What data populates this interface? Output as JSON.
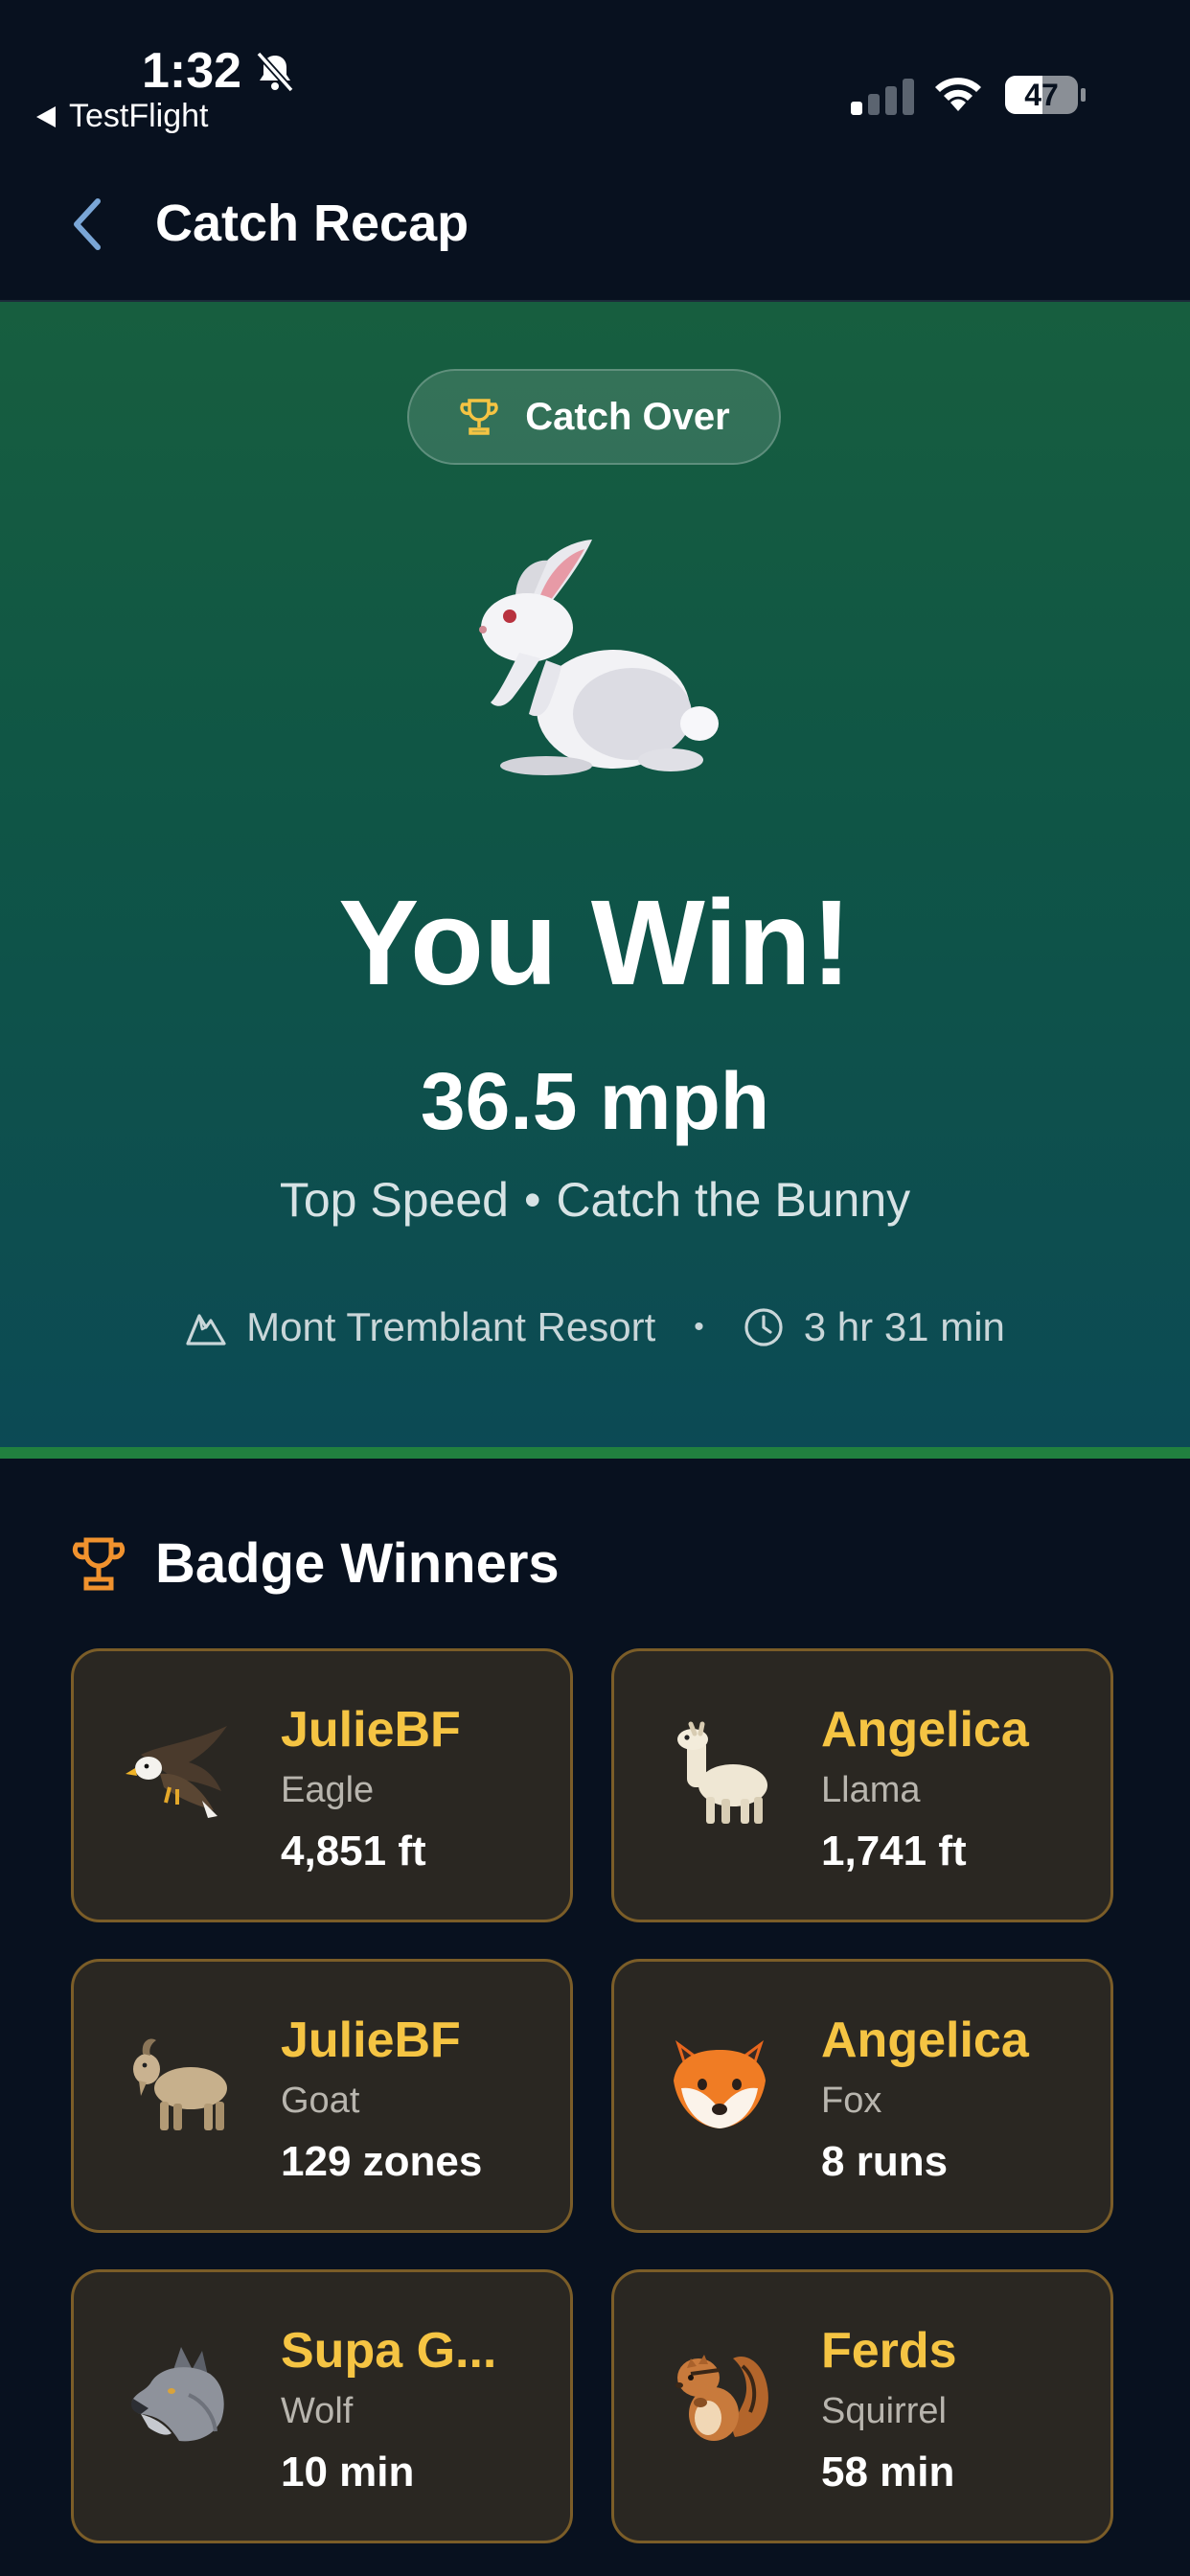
{
  "status_bar": {
    "time": "1:32",
    "back_app": "TestFlight",
    "battery": "47"
  },
  "nav": {
    "title": "Catch Recap"
  },
  "hero": {
    "pill_label": "Catch Over",
    "title": "You Win!",
    "value": "36.5 mph",
    "subtitle_metric": "Top Speed",
    "subtitle_separator": "•",
    "subtitle_game": "Catch the Bunny",
    "location": "Mont Tremblant Resort",
    "meta_separator": "•",
    "duration": "3 hr 31 min"
  },
  "badges": {
    "title": "Badge Winners",
    "items": [
      {
        "name": "JulieBF",
        "animal": "Eagle",
        "value": "4,851 ft",
        "icon": "eagle-icon"
      },
      {
        "name": "Angelica",
        "animal": "Llama",
        "value": "1,741 ft",
        "icon": "llama-icon"
      },
      {
        "name": "JulieBF",
        "animal": "Goat",
        "value": "129 zones",
        "icon": "goat-icon"
      },
      {
        "name": "Angelica",
        "animal": "Fox",
        "value": "8 runs",
        "icon": "fox-icon"
      },
      {
        "name": "Supa G...",
        "animal": "Wolf",
        "value": "10 min",
        "icon": "wolf-icon"
      },
      {
        "name": "Ferds",
        "animal": "Squirrel",
        "value": "58 min",
        "icon": "squirrel-icon"
      }
    ]
  },
  "colors": {
    "background": "#08111f",
    "accent_gold": "#f5c443",
    "card_bg": "#2a2722",
    "card_border": "#7b5d28",
    "hero_green": "#175e3f",
    "hero_teal": "#0c4a55"
  }
}
